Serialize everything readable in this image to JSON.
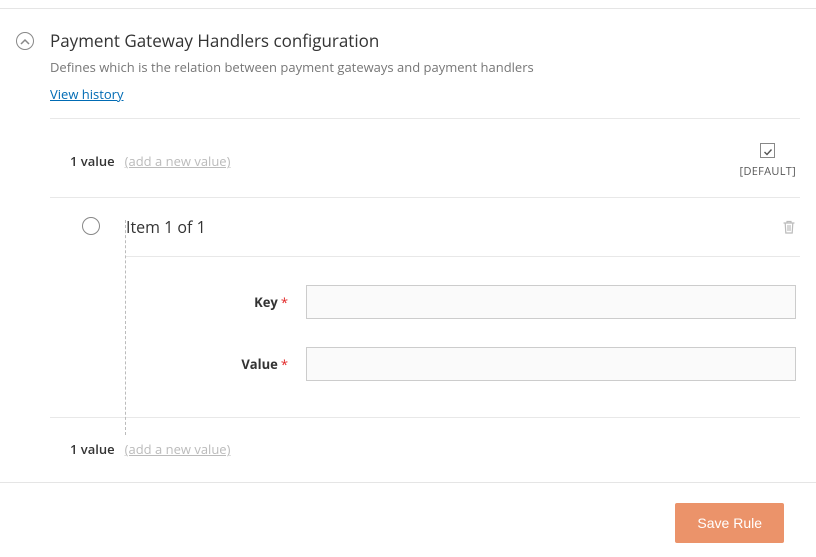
{
  "section": {
    "title": "Payment Gateway Handlers configuration",
    "description": "Defines which is the relation between payment gateways and payment handlers",
    "history_link": "View history"
  },
  "values": {
    "count_label_top": "1 value",
    "add_label_top": "(add a new value)",
    "count_label_bottom": "1 value",
    "add_label_bottom": "(add a new value)"
  },
  "scope": {
    "label": "[DEFAULT]"
  },
  "item": {
    "title": "Item 1 of 1",
    "fields": {
      "key_label": "Key",
      "key_value": "",
      "value_label": "Value",
      "value_value": ""
    }
  },
  "actions": {
    "save": "Save Rule"
  }
}
